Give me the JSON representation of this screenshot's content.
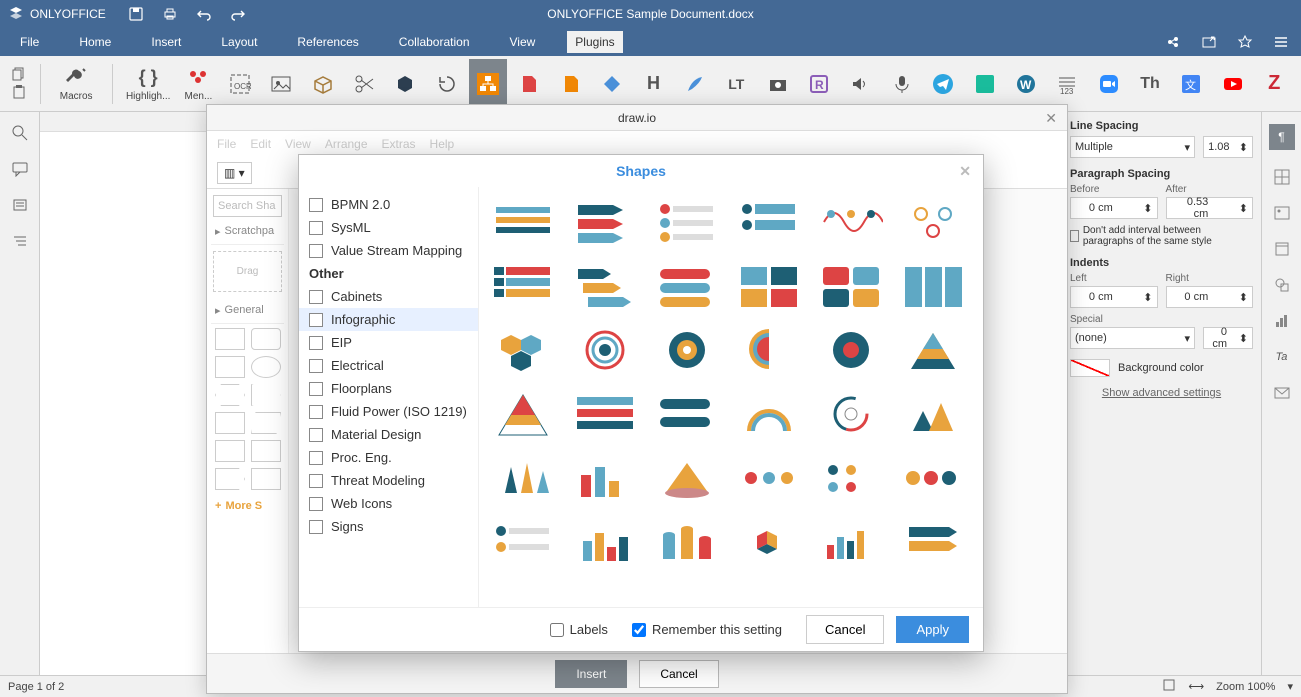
{
  "app": {
    "name": "ONLYOFFICE",
    "doc_title": "ONLYOFFICE Sample Document.docx"
  },
  "menus": {
    "file": "File",
    "home": "Home",
    "insert": "Insert",
    "layout": "Layout",
    "references": "References",
    "collaboration": "Collaboration",
    "view": "View",
    "plugins": "Plugins"
  },
  "plugins_toolbar": {
    "macros": "Macros",
    "highlight": "Highligh...",
    "mendeley": "Men..."
  },
  "drawio": {
    "title": "draw.io",
    "menu": {
      "file": "File",
      "edit": "Edit",
      "view": "View",
      "arrange": "Arrange",
      "extras": "Extras",
      "help": "Help"
    },
    "sidebar": {
      "search_placeholder": "Search Sha",
      "scratchpad": "Scratchpa",
      "drag_hint": "Drag",
      "general": "General",
      "more_shapes": "More S"
    },
    "insert": "Insert",
    "cancel": "Cancel"
  },
  "shapes_dialog": {
    "title": "Shapes",
    "categories": {
      "items_top": [
        "BPMN 2.0",
        "SysML",
        "Value Stream Mapping"
      ],
      "other_header": "Other",
      "items_other": [
        "Cabinets",
        "Infographic",
        "EIP",
        "Electrical",
        "Floorplans",
        "Fluid Power (ISO 1219)",
        "Material Design",
        "Proc. Eng.",
        "Threat Modeling",
        "Web Icons",
        "Signs"
      ]
    },
    "labels_chk": "Labels",
    "remember_chk": "Remember this setting",
    "cancel": "Cancel",
    "apply": "Apply"
  },
  "right_panel": {
    "line_spacing": "Line Spacing",
    "line_spacing_mode": "Multiple",
    "line_spacing_value": "1.08",
    "paragraph_spacing": "Paragraph Spacing",
    "before": "Before",
    "before_val": "0 cm",
    "after": "After",
    "after_val": "0.53 cm",
    "no_interval": "Don't add interval between paragraphs of the same style",
    "indents": "Indents",
    "left": "Left",
    "left_val": "0 cm",
    "right": "Right",
    "right_val": "0 cm",
    "special": "Special",
    "special_mode": "(none)",
    "special_val": "0 cm",
    "bg_color": "Background color",
    "advanced": "Show advanced settings"
  },
  "statusbar": {
    "page": "Page 1 of 2",
    "zoom": "Zoom 100%"
  }
}
